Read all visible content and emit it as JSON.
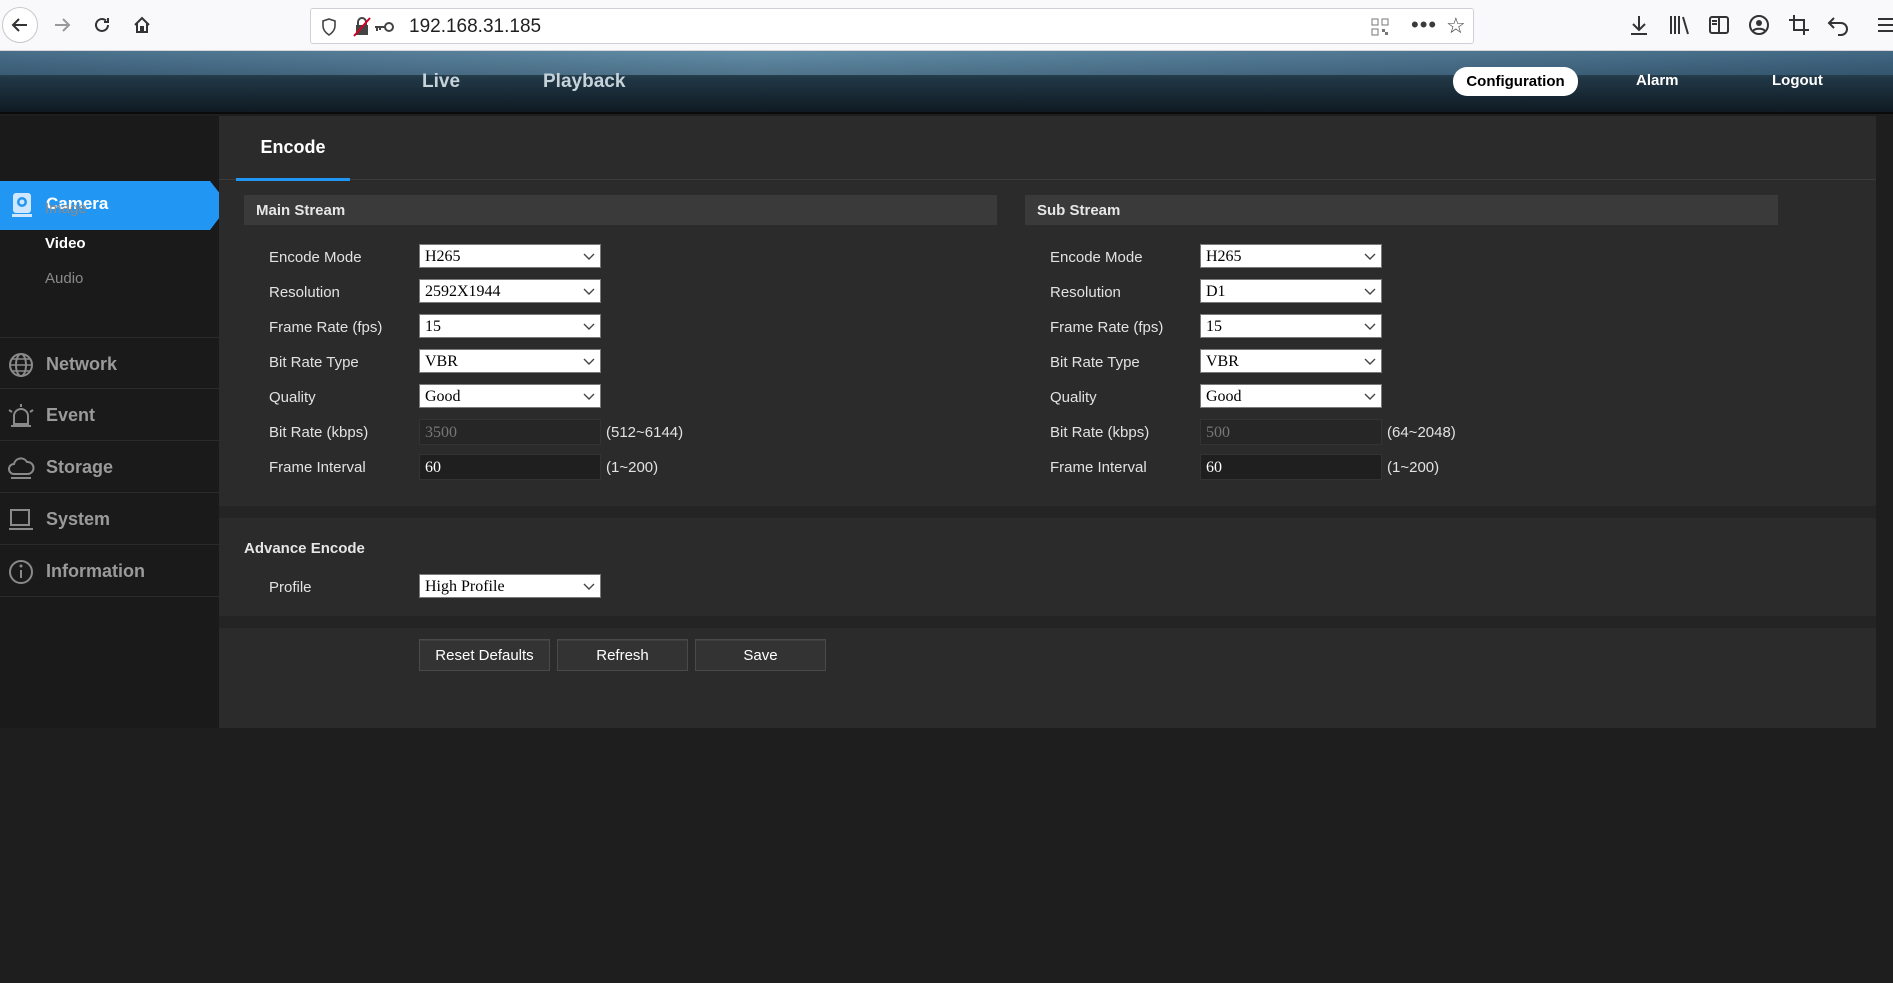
{
  "browser": {
    "url": "192.168.31.185"
  },
  "header": {
    "tabs": [
      {
        "label": "Live"
      },
      {
        "label": "Playback"
      }
    ],
    "right": {
      "configuration": "Configuration",
      "alarm": "Alarm",
      "logout": "Logout"
    }
  },
  "sidebar": {
    "camera": {
      "label": "Camera",
      "subitems": [
        {
          "label": "Image",
          "active": false
        },
        {
          "label": "Video",
          "active": true
        },
        {
          "label": "Audio",
          "active": false
        }
      ]
    },
    "items": [
      {
        "label": "Network",
        "icon": "globe-icon"
      },
      {
        "label": "Event",
        "icon": "alarm-bell-icon"
      },
      {
        "label": "Storage",
        "icon": "cloud-storage-icon"
      },
      {
        "label": "System",
        "icon": "computer-icon"
      },
      {
        "label": "Information",
        "icon": "info-icon"
      }
    ]
  },
  "main": {
    "tab": "Encode",
    "main_stream": {
      "title": "Main Stream",
      "encode_mode": {
        "label": "Encode Mode",
        "value": "H265"
      },
      "resolution": {
        "label": "Resolution",
        "value": "2592X1944"
      },
      "frame_rate": {
        "label": "Frame Rate (fps)",
        "value": "15"
      },
      "bit_rate_type": {
        "label": "Bit Rate Type",
        "value": "VBR"
      },
      "quality": {
        "label": "Quality",
        "value": "Good"
      },
      "bit_rate": {
        "label": "Bit Rate (kbps)",
        "value": "3500",
        "range": "(512~6144)"
      },
      "frame_interval": {
        "label": "Frame Interval",
        "value": "60",
        "range": "(1~200)"
      }
    },
    "sub_stream": {
      "title": "Sub Stream",
      "encode_mode": {
        "label": "Encode Mode",
        "value": "H265"
      },
      "resolution": {
        "label": "Resolution",
        "value": "D1"
      },
      "frame_rate": {
        "label": "Frame Rate (fps)",
        "value": "15"
      },
      "bit_rate_type": {
        "label": "Bit Rate Type",
        "value": "VBR"
      },
      "quality": {
        "label": "Quality",
        "value": "Good"
      },
      "bit_rate": {
        "label": "Bit Rate (kbps)",
        "value": "500",
        "range": "(64~2048)"
      },
      "frame_interval": {
        "label": "Frame Interval",
        "value": "60",
        "range": "(1~200)"
      }
    },
    "advance": {
      "title": "Advance Encode",
      "profile": {
        "label": "Profile",
        "value": "High Profile"
      }
    },
    "buttons": {
      "reset": "Reset Defaults",
      "refresh": "Refresh",
      "save": "Save"
    }
  },
  "colors": {
    "accent": "#2196f3",
    "panel": "#2b2b2b",
    "sidebar": "#1a1a1a"
  }
}
